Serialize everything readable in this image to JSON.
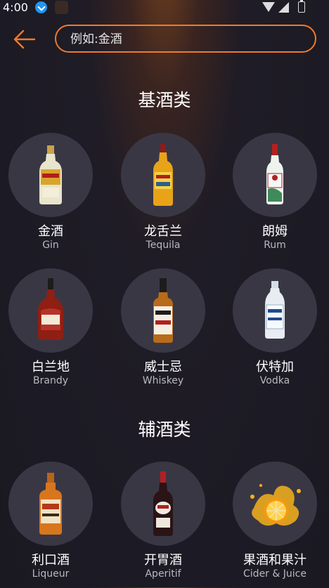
{
  "status_bar": {
    "time": "4:00"
  },
  "search": {
    "placeholder": "例如:金酒",
    "value": ""
  },
  "sections": [
    {
      "title": "基酒类",
      "items": [
        {
          "name": "金酒",
          "sub": "Gin",
          "icon": "gin-bottle-icon"
        },
        {
          "name": "龙舌兰",
          "sub": "Tequila",
          "icon": "tequila-bottle-icon"
        },
        {
          "name": "朗姆",
          "sub": "Rum",
          "icon": "rum-bottle-icon"
        },
        {
          "name": "白兰地",
          "sub": "Brandy",
          "icon": "brandy-bottle-icon"
        },
        {
          "name": "威士忌",
          "sub": "Whiskey",
          "icon": "whiskey-bottle-icon"
        },
        {
          "name": "伏特加",
          "sub": "Vodka",
          "icon": "vodka-bottle-icon"
        }
      ]
    },
    {
      "title": "辅酒类",
      "items": [
        {
          "name": "利口酒",
          "sub": "Liqueur",
          "icon": "liqueur-bottle-icon"
        },
        {
          "name": "开胃酒",
          "sub": "Aperitif",
          "icon": "aperitif-bottle-icon"
        },
        {
          "name": "果酒和果汁",
          "sub": "Cider & Juice",
          "icon": "orange-splash-icon"
        }
      ]
    }
  ],
  "colors": {
    "accent": "#f07a2c",
    "background": "#1a1922",
    "circle": "#3a3745"
  }
}
